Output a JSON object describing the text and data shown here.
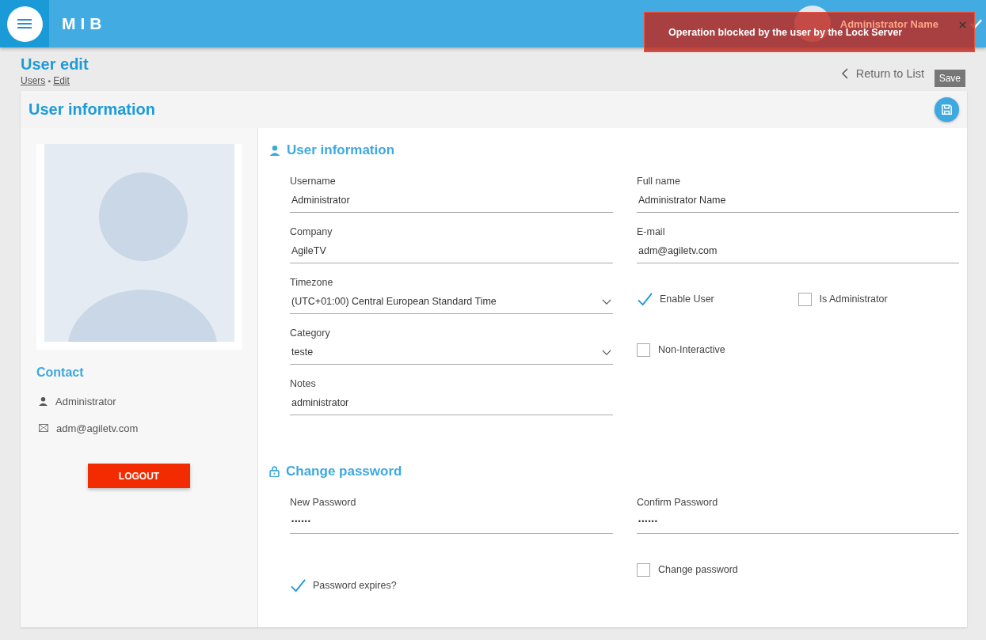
{
  "header": {
    "logo": "MIB",
    "user_name": "Administrator Name"
  },
  "toast": {
    "message": "Operation blocked by the user by the Lock Server"
  },
  "page": {
    "title": "User edit",
    "breadcrumb": [
      "Users",
      "Edit"
    ],
    "breadcrumb_separator": "•",
    "return_link": "Return to List",
    "save_tooltip": "Save"
  },
  "card": {
    "title": "User information"
  },
  "profile": {
    "contact_title": "Contact",
    "contact": [
      {
        "kind": "person",
        "text": "Administrator"
      },
      {
        "kind": "email",
        "text": "adm@agiletv.com"
      }
    ],
    "logout": "LOGOUT"
  },
  "sections": [
    {
      "kind": "person",
      "title": "User information",
      "left": [
        {
          "kind": "text",
          "label": "Username",
          "value": "Administrator"
        },
        {
          "kind": "text",
          "label": "Company",
          "value": "AgileTV"
        },
        {
          "kind": "select",
          "label": "Timezone",
          "value": "(UTC+01:00) Central European Standard Time"
        },
        {
          "kind": "select",
          "label": "Category",
          "value": "teste"
        },
        {
          "kind": "text",
          "label": "Notes",
          "value": "administrator"
        }
      ],
      "right": [
        {
          "kind": "text",
          "label": "Full name",
          "value": "Administrator Name"
        },
        {
          "kind": "text",
          "label": "E-mail",
          "value": "adm@agiletv.com"
        },
        {
          "kind": "checks",
          "checks": [
            {
              "label": "Enable User",
              "checked": true
            },
            {
              "label": "Is Administrator",
              "checked": false
            }
          ]
        },
        {
          "kind": "checks",
          "checks": [
            {
              "label": "Non-Interactive",
              "checked": false
            }
          ]
        }
      ]
    },
    {
      "kind": "lock",
      "title": "Change password",
      "left": [
        {
          "kind": "password",
          "label": "New Password",
          "value": "••••••"
        },
        {
          "kind": "checks",
          "checks": [
            {
              "label": "Password expires?",
              "checked": true
            }
          ]
        }
      ],
      "right": [
        {
          "kind": "password",
          "label": "Confirm Password",
          "value": "••••••"
        },
        {
          "kind": "checks",
          "checks": [
            {
              "label": "Change password",
              "checked": false
            }
          ]
        }
      ]
    }
  ]
}
